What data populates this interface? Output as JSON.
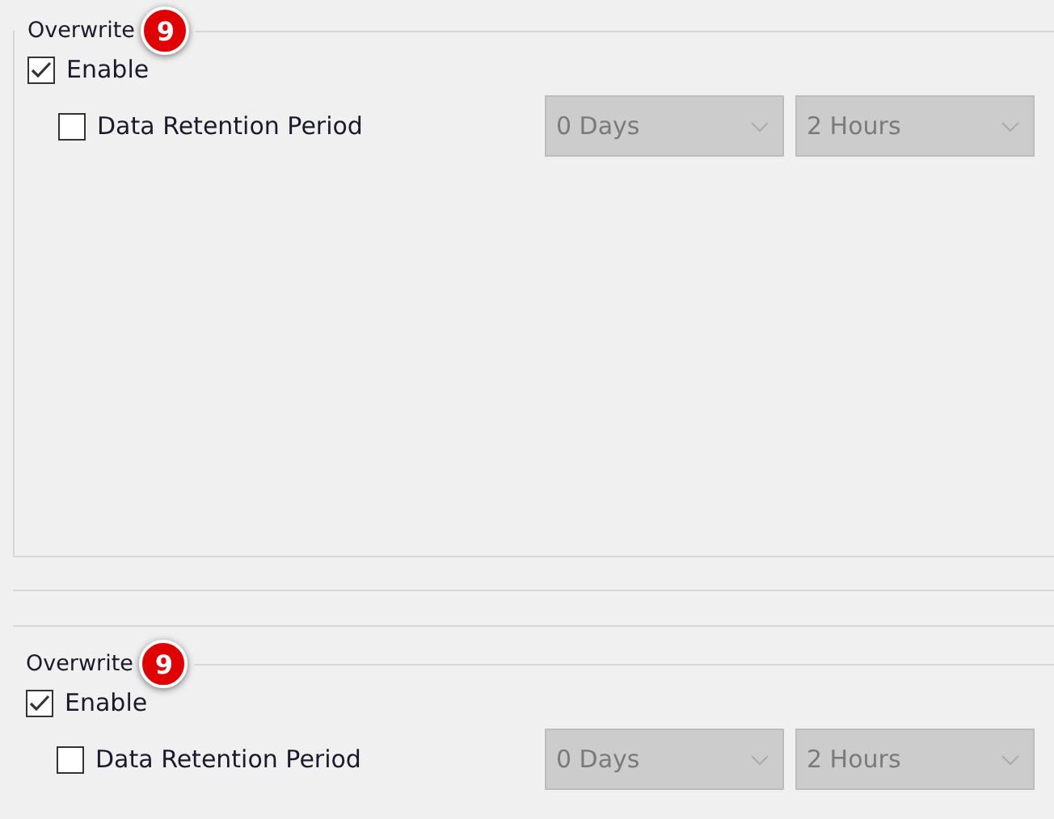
{
  "groups": [
    {
      "title": "Overwrite",
      "badge": "9",
      "enable": {
        "label": "Enable",
        "checked": true
      },
      "retention": {
        "label": "Data Retention Period",
        "checked": false,
        "days": {
          "value": "0 Days",
          "disabled": true
        },
        "hours": {
          "value": "2 Hours",
          "disabled": true
        }
      }
    },
    {
      "title": "Overwrite",
      "badge": "9",
      "enable": {
        "label": "Enable",
        "checked": true
      },
      "retention": {
        "label": "Data Retention Period",
        "checked": false,
        "days": {
          "value": "0 Days",
          "disabled": true
        },
        "hours": {
          "value": "2 Hours",
          "disabled": true
        }
      }
    }
  ]
}
